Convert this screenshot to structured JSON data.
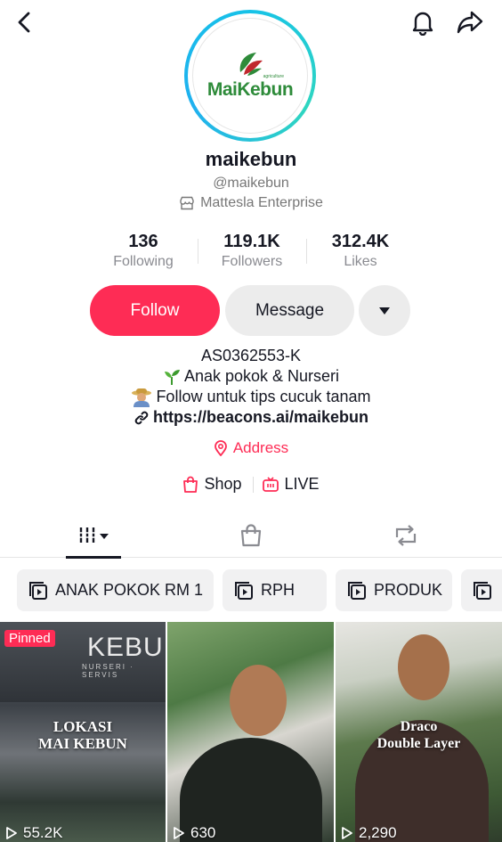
{
  "profile": {
    "logo_text": "MaiKebun",
    "logo_sub": "agriculture",
    "username": "maikebun",
    "handle": "@maikebun",
    "enterprise": "Mattesla Enterprise"
  },
  "stats": [
    {
      "value": "136",
      "label": "Following"
    },
    {
      "value": "119.1K",
      "label": "Followers"
    },
    {
      "value": "312.4K",
      "label": "Likes"
    }
  ],
  "actions": {
    "follow": "Follow",
    "message": "Message"
  },
  "bio": {
    "line1": "AS0362553-K",
    "line2": "Anak pokok & Nurseri",
    "line3": "Follow untuk tips cucuk tanam",
    "link": "https://beacons.ai/maikebun",
    "address": "Address"
  },
  "shortcuts": {
    "shop": "Shop",
    "live": "LIVE"
  },
  "playlists": [
    "ANAK POKOK RM 1",
    "RPH",
    "PRODUK",
    ""
  ],
  "videos": [
    {
      "pinned": "Pinned",
      "sign": "KEBUN",
      "sign_sub": "NURSERI · SERVIS",
      "title": "LOKASI\nMAI KEBUN",
      "views": "55.2K"
    },
    {
      "views": "630"
    },
    {
      "title": "Draco\nDouble Layer",
      "views": "2,290"
    }
  ],
  "colors": {
    "accent": "#fe2c55",
    "ring": "#16c2e8",
    "text": "#161823",
    "muted": "#8a8b91"
  }
}
